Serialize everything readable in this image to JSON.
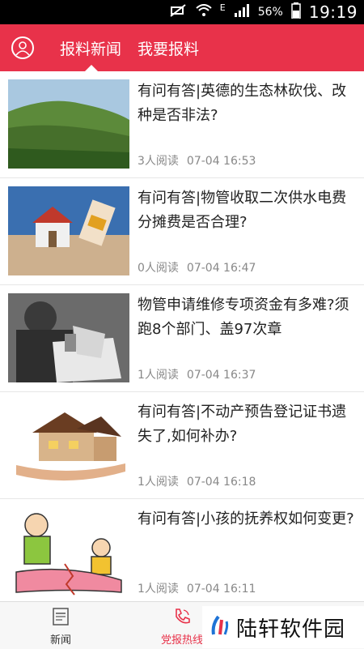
{
  "status_bar": {
    "time": "19:19",
    "battery": "56%",
    "network": "E",
    "icons": [
      "mute-icon",
      "wifi-icon",
      "signal-icon",
      "battery-icon"
    ]
  },
  "header": {
    "tabs": [
      {
        "label": "报料新闻",
        "active": true
      },
      {
        "label": "我要报料",
        "active": false
      }
    ],
    "accent_color": "#e8324a"
  },
  "articles": [
    {
      "title": "有问有答|英德的生态林砍伐、改种是否非法?",
      "reads": "3人阅读",
      "time": "07-04 16:53",
      "image": "forest-hillside-photo"
    },
    {
      "title": "有问有答|物管收取二次供水电费分摊费是否合理?",
      "reads": "0人阅读",
      "time": "07-04 16:47",
      "image": "house-in-hands-photo"
    },
    {
      "title": "物管申请维修专项资金有多难?须跑8个部门、盖97次章",
      "reads": "1人阅读",
      "time": "07-04 16:37",
      "image": "stamping-documents-photo"
    },
    {
      "title": "有问有答|不动产预告登记证书遗失了,如何补办?",
      "reads": "1人阅读",
      "time": "07-04 16:18",
      "image": "house-model-on-hand-photo"
    },
    {
      "title": "有问有答|小孩的抚养权如何变更?",
      "reads": "1人阅读",
      "time": "07-04 16:11",
      "image": "custody-cartoon"
    }
  ],
  "bottom_nav": [
    {
      "label": "新闻",
      "icon": "news-icon",
      "active": false
    },
    {
      "label": "党报热线",
      "icon": "phone-icon",
      "active": true
    }
  ],
  "watermark": {
    "text": "陆轩软件园"
  }
}
